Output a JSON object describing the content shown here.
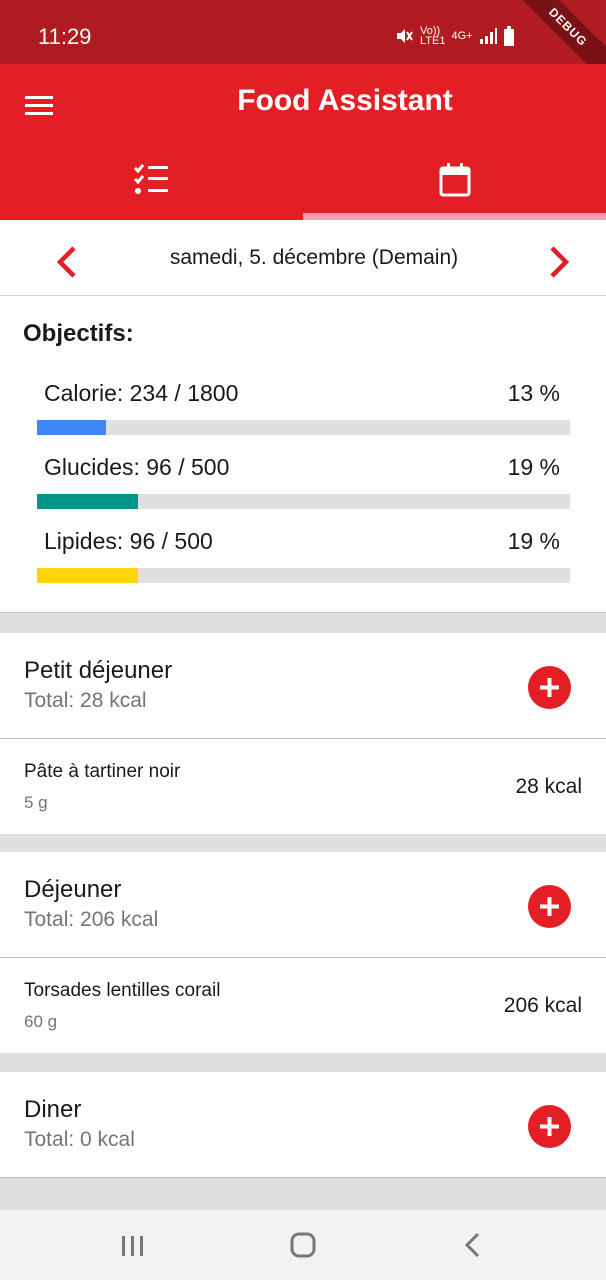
{
  "status_bar": {
    "time": "11:29",
    "network_top": "Vo))",
    "network_bottom": "LTE1",
    "signal": "4G+",
    "debug_label": "DEBUG"
  },
  "colors": {
    "primary": "#e31e24",
    "status_bar": "#b01b1f",
    "tab_indicator": "#f39db2"
  },
  "app_bar": {
    "title": "Food Assistant",
    "menu_icon": "hamburger-menu-icon",
    "tabs": [
      {
        "icon": "checklist-icon",
        "selected": false
      },
      {
        "icon": "calendar-icon",
        "selected": true
      }
    ]
  },
  "date_nav": {
    "prev_icon": "chevron-left-icon",
    "next_icon": "chevron-right-icon",
    "date": "samedi, 5. décembre (Demain)"
  },
  "objectives": {
    "title": "Objectifs:",
    "goals": [
      {
        "label": "Calorie: 234 / 1800",
        "percent_text": "13 %",
        "progress": 0.13,
        "color": "#4285f4"
      },
      {
        "label": "Glucides: 96 / 500",
        "percent_text": "19 %",
        "progress": 0.19,
        "color": "#00968a"
      },
      {
        "label": "Lipides: 96 / 500",
        "percent_text": "19 %",
        "progress": 0.19,
        "color": "#fdd50f"
      }
    ]
  },
  "meals": [
    {
      "name": "Petit déjeuner",
      "total": "Total: 28 kcal",
      "items": [
        {
          "name": "Pâte à tartiner noir",
          "qty": "5 g",
          "kcal": "28 kcal"
        }
      ]
    },
    {
      "name": "Déjeuner",
      "total": "Total: 206 kcal",
      "items": [
        {
          "name": "Torsades lentilles corail",
          "qty": "60 g",
          "kcal": "206 kcal"
        }
      ]
    },
    {
      "name": "Diner",
      "total": "Total: 0 kcal",
      "items": []
    }
  ],
  "nav_bar": {
    "recents_icon": "recents-icon",
    "home_icon": "home-icon",
    "back_icon": "back-icon"
  }
}
